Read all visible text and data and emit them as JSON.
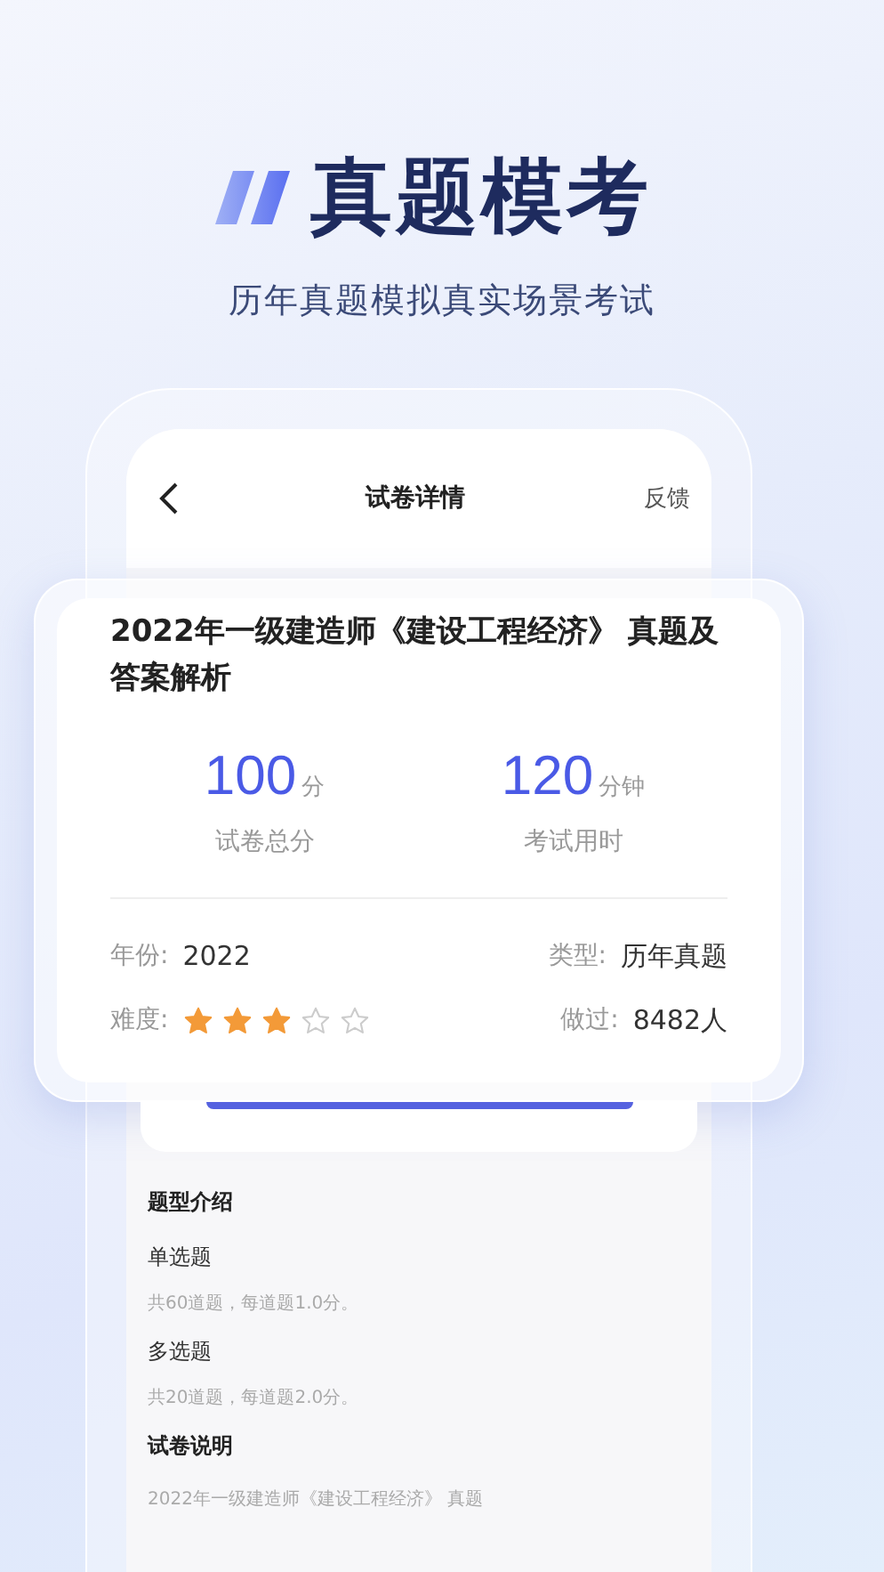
{
  "headline": {
    "title": "真题模考",
    "subtitle": "历年真题模拟真实场景考试"
  },
  "nav": {
    "title": "试卷详情",
    "action": "反馈"
  },
  "card": {
    "title": "2022年一级建造师《建设工程经济》 真题及答案解析",
    "stats": [
      {
        "value": "100",
        "unit": "分",
        "label": "试卷总分"
      },
      {
        "value": "120",
        "unit": "分钟",
        "label": "考试用时"
      }
    ],
    "year": {
      "label": "年份:",
      "value": "2022"
    },
    "type": {
      "label": "类型:",
      "value": "历年真题"
    },
    "difficulty": {
      "label": "难度:",
      "stars": 3
    },
    "taken": {
      "label": "做过:",
      "value": "8482人"
    }
  },
  "intro": {
    "heading": "题型介绍",
    "items": [
      {
        "name": "单选题",
        "desc": "共60道题，每道题1.0分。"
      },
      {
        "name": "多选题",
        "desc": "共20道题，每道题2.0分。"
      }
    ]
  },
  "notes": {
    "heading": "试卷说明",
    "text": "2022年一级建造师《建设工程经济》 真题"
  }
}
